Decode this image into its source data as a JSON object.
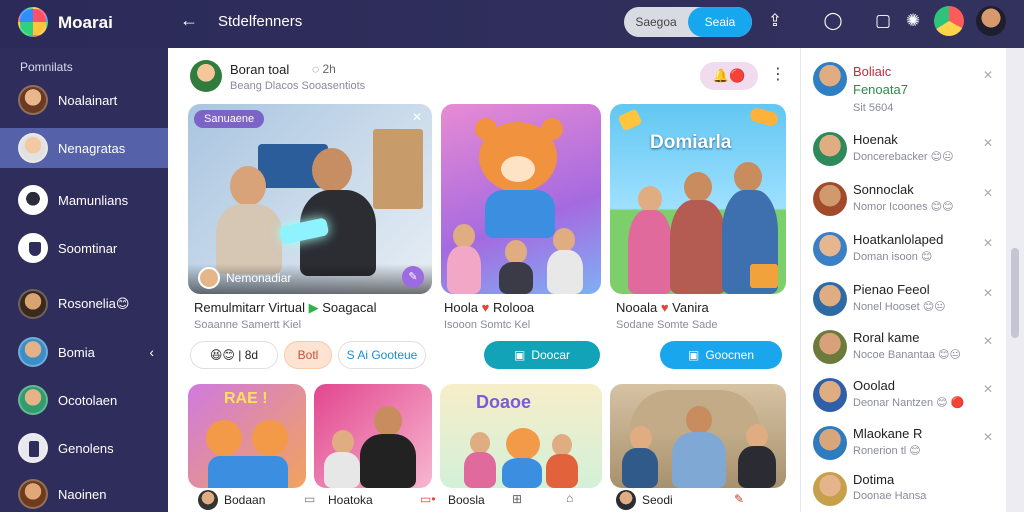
{
  "app": {
    "title": "Moarai"
  },
  "header": {
    "page_title": "Stdelfenners",
    "segments": [
      "Saegoa",
      "Seaia"
    ],
    "active_segment": 1
  },
  "sidebar": {
    "heading": "Pomnilats",
    "items": [
      {
        "label": "Noalainart",
        "avatar_color": "#c27a4a"
      },
      {
        "label": "Nenagratas",
        "avatar_color": "#d9a26e"
      },
      {
        "label": "Mamunlians",
        "avatar_color": "#f0f0f0"
      },
      {
        "label": "Soomtinar",
        "avatar_color": "#ffffff"
      },
      {
        "label": "Rosonelia😊",
        "avatar_color": "#9c6a43"
      },
      {
        "label": "Bomia",
        "avatar_color": "#3a8fc9"
      },
      {
        "label": "Ocotolaen",
        "avatar_color": "#3db07a"
      },
      {
        "label": "Genolens",
        "avatar_color": "#e8e8e8"
      },
      {
        "label": "Naoinen",
        "avatar_color": "#b5793f"
      }
    ]
  },
  "post": {
    "author": "Boran toal",
    "meta": "2h",
    "subline": "Beang Dlacos Sooasentiots",
    "reactions": "🔔🔴"
  },
  "cards_top": [
    {
      "tag": "Sanuaene",
      "caption": "Nemonadiar",
      "title": "Remulmitarr Virtual",
      "title_extra": "Soagacal",
      "sub": "Soaanne Samertt Kiel",
      "accent": "#6c9fd6"
    },
    {
      "title": "Hoola",
      "title_extra": "Rolooa",
      "sub": "Isooon Somtc Kel"
    },
    {
      "banner": "Domiarla",
      "title": "Nooala",
      "title_extra": "Vanira",
      "sub": "Sodane Somte Sade"
    }
  ],
  "chips": [
    {
      "label": "😆😊 | 8d",
      "style": "plain"
    },
    {
      "label": "Botl",
      "style": "peach"
    },
    {
      "label": "S Ai Gooteue",
      "style": "outline"
    }
  ],
  "buttons": [
    {
      "label": "Doocar",
      "color": "#12a3b8"
    },
    {
      "label": "Goocnen",
      "color": "#1aa6ec"
    }
  ],
  "cards_bottom": [
    {
      "label": "Bodaan",
      "banner": "RAE !"
    },
    {
      "label": "Hoatoka"
    },
    {
      "label": "Boosla",
      "banner": "Doaoe"
    },
    {
      "label": "Seodi"
    }
  ],
  "right_panel": {
    "top": {
      "name": "Boliaic",
      "name2": "Fenoata7",
      "sub": "Sit 5604"
    },
    "items": [
      {
        "name": "Hoenak",
        "sub": "Doncerebacker 😊😐",
        "avatar": "#2e8a5a"
      },
      {
        "name": "Sonnoclak",
        "sub": "Nomor Icoones 😊😊",
        "avatar": "#a24a2c"
      },
      {
        "name": "Hoatkanlolaped",
        "sub": "Doman isoon 😊",
        "avatar": "#3b7fc4"
      },
      {
        "name": "Pienao Feeol",
        "sub": "Nonel Hooset 😊😐",
        "avatar": "#2e6aa3"
      },
      {
        "name": "Roral kame",
        "sub": "Nocoe Banantaa 😊😐",
        "avatar": "#6c7b3c"
      },
      {
        "name": "Ooolad",
        "sub": "Deonar Nantzen 😊 🔴",
        "avatar": "#2f5fa8"
      },
      {
        "name": "Mlaokane R",
        "sub": "Ronerion tl 😊",
        "avatar": "#2e7cc0"
      },
      {
        "name": "Dotima",
        "sub": "Doonae Hansa",
        "avatar": "#c6a04a"
      }
    ]
  }
}
